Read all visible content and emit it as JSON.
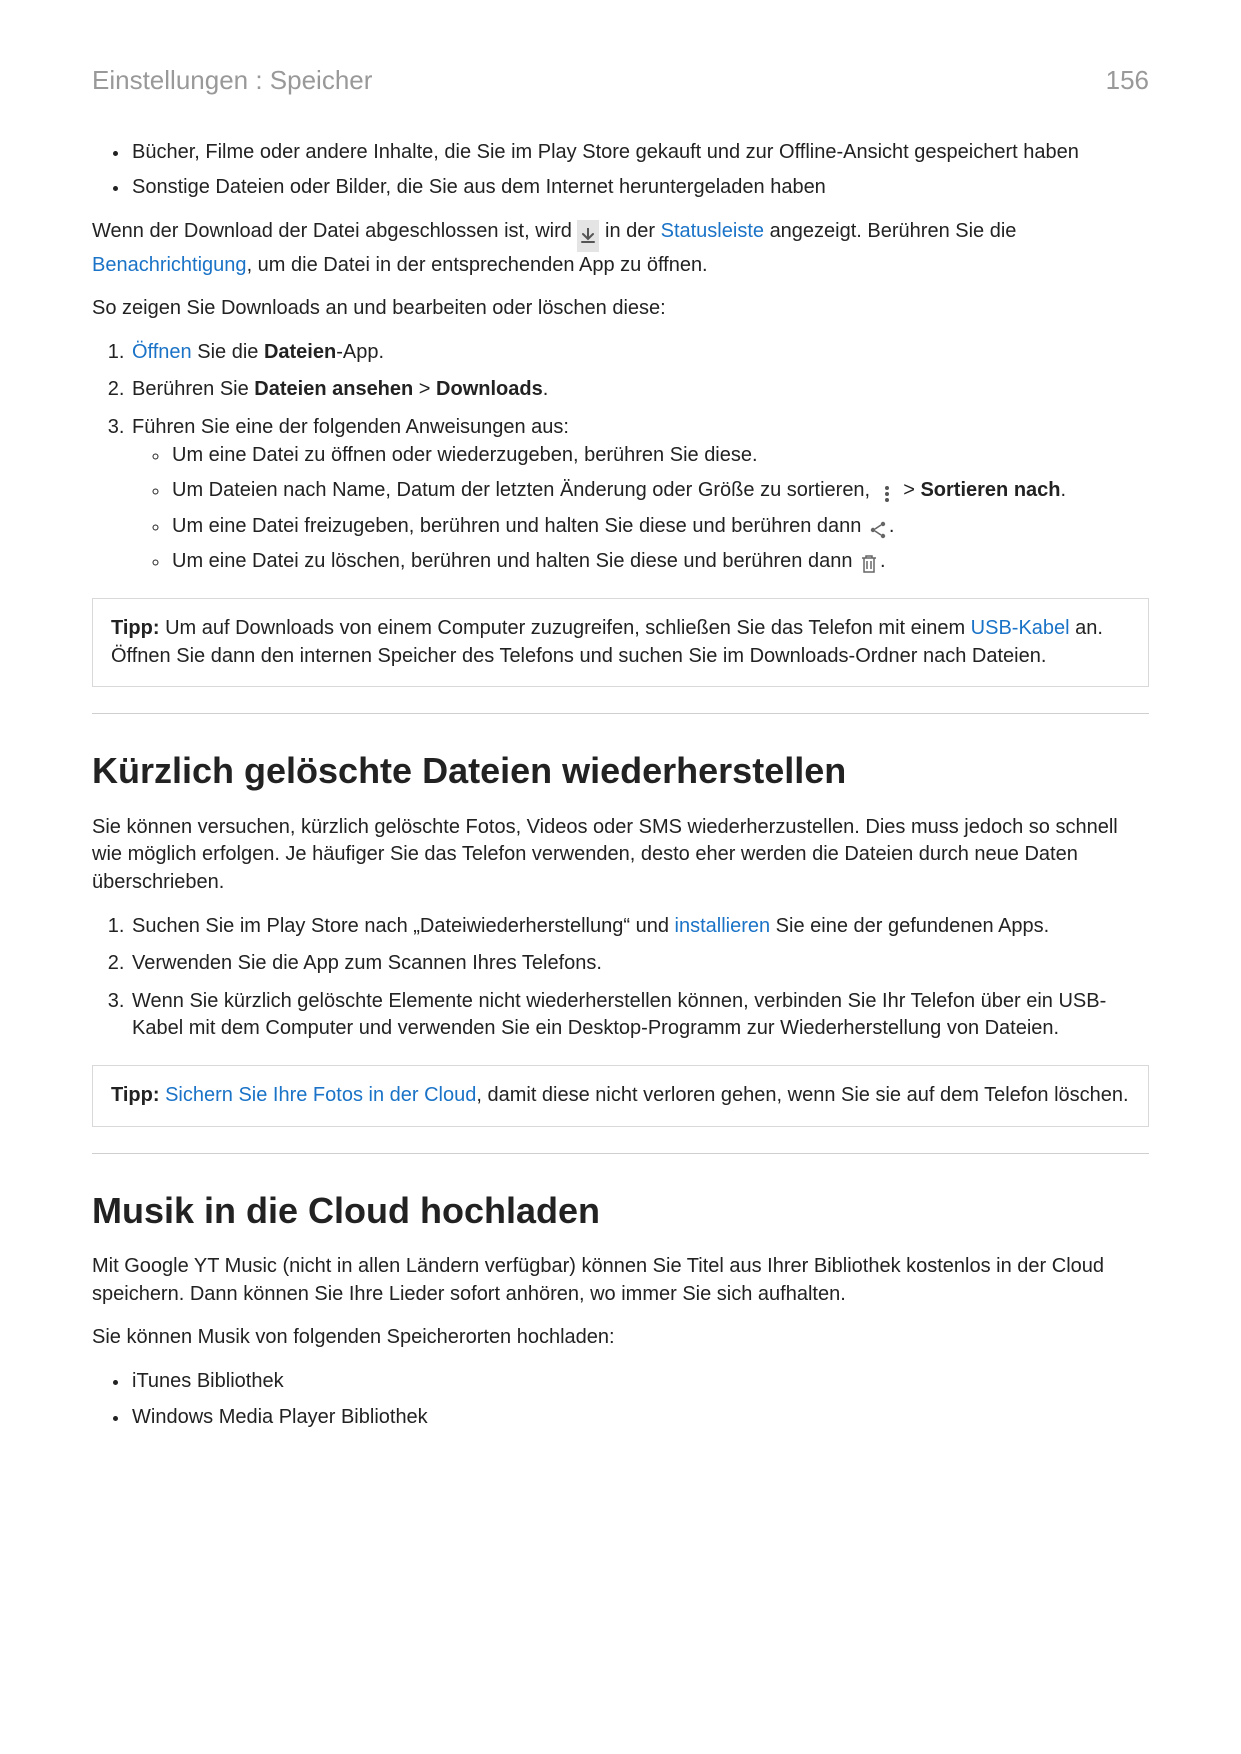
{
  "header": {
    "breadcrumb": "Einstellungen : Speicher",
    "page": "156"
  },
  "intro_list": {
    "item1": "Bücher, Filme oder andere Inhalte, die Sie im Play Store gekauft und zur Offline-Ansicht gespeichert haben",
    "item2": "Sonstige Dateien oder Bilder, die Sie aus dem Internet heruntergeladen haben"
  },
  "para1": {
    "pre": "Wenn der Download der Datei abgeschlossen ist, wird ",
    "mid1": " in der ",
    "link_status": "Statusleiste",
    "mid2": " angezeigt. Berühren Sie die ",
    "link_notif": "Benachrichtigung",
    "post": ", um die Datei in der entsprechenden App zu öffnen."
  },
  "para2": "So zeigen Sie Downloads an und bearbeiten oder löschen diese:",
  "steps1": {
    "s1_link": "Öffnen",
    "s1_mid": " Sie die ",
    "s1_bold": "Dateien",
    "s1_post": "-App.",
    "s2_pre": "Berühren Sie ",
    "s2_b1": "Dateien ansehen",
    "s2_gt": " > ",
    "s2_b2": "Downloads",
    "s2_post": ".",
    "s3": "Führen Sie eine der folgenden Anweisungen aus:",
    "s3a": "Um eine Datei zu öffnen oder wiederzugeben, berühren Sie diese.",
    "s3b_pre": "Um Dateien nach Name, Datum der letzten Änderung oder Größe zu sortieren, ",
    "s3b_gt": " > ",
    "s3b_bold": "Sortieren nach",
    "s3b_post": ".",
    "s3c_pre": "Um eine Datei freizugeben, berühren und halten Sie diese und berühren dann ",
    "s3c_post": ".",
    "s3d_pre": "Um eine Datei zu löschen, berühren und halten Sie diese und berühren dann ",
    "s3d_post": "."
  },
  "tip1": {
    "label": "Tipp:",
    "pre": " Um auf Downloads von einem Computer zuzugreifen, schließen Sie das Telefon mit einem ",
    "link": "USB-Kabel",
    "post": " an. Öffnen Sie dann den internen Speicher des Telefons und suchen Sie im Downloads-Ordner nach Dateien."
  },
  "sec2": {
    "title": "Kürzlich gelöschte Dateien wiederherstellen",
    "p1": "Sie können versuchen, kürzlich gelöschte Fotos, Videos oder SMS wiederherzustellen. Dies muss jedoch so schnell wie möglich erfolgen. Je häufiger Sie das Telefon verwenden, desto eher werden die Dateien durch neue Daten überschrieben.",
    "s1_pre": "Suchen Sie im Play Store nach „Dateiwiederherstellung“ und ",
    "s1_link": "installieren",
    "s1_post": " Sie eine der gefundenen Apps.",
    "s2": "Verwenden Sie die App zum Scannen Ihres Telefons.",
    "s3": "Wenn Sie kürzlich gelöschte Elemente nicht wiederherstellen können, verbinden Sie Ihr Telefon über ein USB-Kabel mit dem Computer und verwenden Sie ein Desktop-Programm zur Wiederherstellung von Dateien."
  },
  "tip2": {
    "label": "Tipp:",
    "spacer": "  ",
    "link": "Sichern Sie Ihre Fotos in der Cloud",
    "post": ", damit diese nicht verloren gehen, wenn Sie sie auf dem Telefon löschen."
  },
  "sec3": {
    "title": "Musik in die Cloud hochladen",
    "p1": "Mit Google YT Music (nicht in allen Ländern verfügbar) können Sie Titel aus Ihrer Bibliothek kostenlos in der Cloud speichern. Dann können Sie Ihre Lieder sofort anhören, wo immer Sie sich aufhalten.",
    "p2": "Sie können Musik von folgenden Speicherorten hochladen:",
    "li1": "iTunes Bibliothek",
    "li2": "Windows Media Player Bibliothek"
  }
}
